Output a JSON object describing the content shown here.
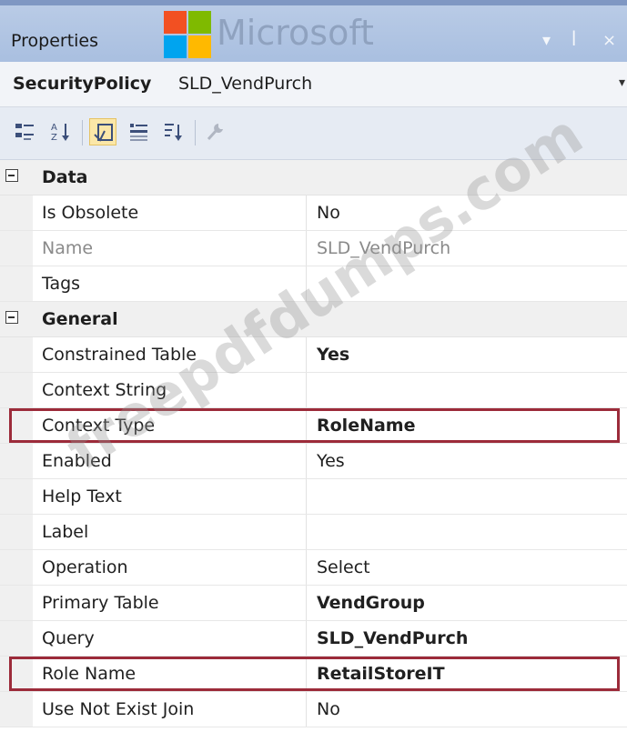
{
  "window": {
    "title": "Properties",
    "watermark_logo_text": "Microsoft",
    "controls": {
      "dropdown": "▾",
      "pin": "ꟾ",
      "close": "×"
    }
  },
  "object_selector": {
    "type": "SecurityPolicy",
    "name": "SLD_VendPurch",
    "dropdown_glyph": "▾"
  },
  "toolbar": {
    "buttons": [
      {
        "icon": "categorized-icon",
        "selected": false
      },
      {
        "icon": "alphabetical-sort-icon",
        "selected": false
      },
      {
        "icon": "properties-icon",
        "selected": true
      },
      {
        "icon": "events-icon",
        "selected": false
      },
      {
        "icon": "property-pages-icon",
        "selected": false
      },
      {
        "icon": "wrench-icon",
        "selected": false
      }
    ]
  },
  "categories": {
    "data": {
      "label": "Data"
    },
    "general": {
      "label": "General"
    }
  },
  "rows": [
    {
      "name": "Is Obsolete",
      "value": "No"
    },
    {
      "name": "Name",
      "value": "SLD_VendPurch"
    },
    {
      "name": "Tags",
      "value": ""
    },
    {
      "name": "Constrained Table",
      "value": "Yes"
    },
    {
      "name": "Context String",
      "value": ""
    },
    {
      "name": "Context Type",
      "value": "RoleName"
    },
    {
      "name": "Enabled",
      "value": "Yes"
    },
    {
      "name": "Help Text",
      "value": ""
    },
    {
      "name": "Label",
      "value": ""
    },
    {
      "name": "Operation",
      "value": "Select"
    },
    {
      "name": "Primary Table",
      "value": "VendGroup"
    },
    {
      "name": "Query",
      "value": "SLD_VendPurch"
    },
    {
      "name": "Role Name",
      "value": "RetailStoreIT"
    },
    {
      "name": "Use Not Exist Join",
      "value": "No"
    }
  ],
  "watermark_text": "freepdfdumps.com",
  "colors": {
    "highlight_border": "#9c2b3a",
    "titlebar": "#b9cbe6",
    "toolbar": "#e6ebf3"
  }
}
